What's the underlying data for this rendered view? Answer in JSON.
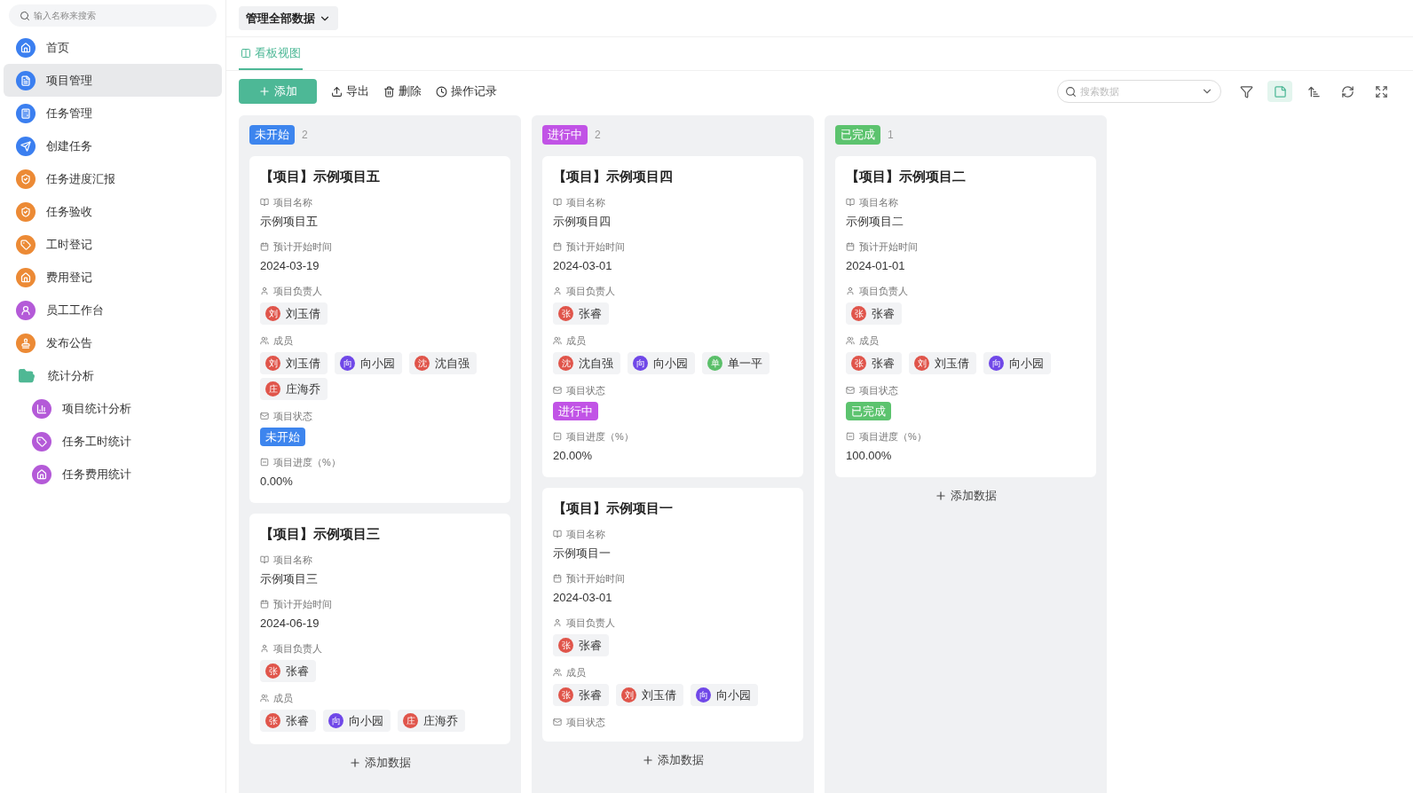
{
  "sidebar": {
    "search": {
      "placeholder": "输入名称来搜索"
    },
    "items": [
      {
        "label": "首页",
        "color": "#3b7ff0",
        "selected": false
      },
      {
        "label": "项目管理",
        "color": "#3b7ff0",
        "selected": true
      },
      {
        "label": "任务管理",
        "color": "#3b7ff0",
        "selected": false
      },
      {
        "label": "创建任务",
        "color": "#3b7ff0",
        "selected": false
      },
      {
        "label": "任务进度汇报",
        "color": "#ec8a35",
        "selected": false
      },
      {
        "label": "任务验收",
        "color": "#ec8a35",
        "selected": false
      },
      {
        "label": "工时登记",
        "color": "#ec8a35",
        "selected": false
      },
      {
        "label": "费用登记",
        "color": "#ec8a35",
        "selected": false
      },
      {
        "label": "员工工作台",
        "color": "#b45ad8",
        "selected": false
      },
      {
        "label": "发布公告",
        "color": "#ec8a35",
        "selected": false
      },
      {
        "label": "统计分析",
        "color": "#4fb894",
        "selected": false,
        "expanded": true,
        "children": [
          {
            "label": "项目统计分析",
            "color": "#b45ad8",
            "selected": false
          },
          {
            "label": "任务工时统计",
            "color": "#b45ad8",
            "selected": false
          },
          {
            "label": "任务费用统计",
            "color": "#b45ad8",
            "selected": false
          }
        ]
      }
    ]
  },
  "scope_dropdown": "管理全部数据",
  "tabs": [
    {
      "label": "看板视图",
      "selected": true
    }
  ],
  "toolbar": {
    "actions": [
      {
        "kind": "add",
        "label": "添加"
      },
      {
        "kind": "export",
        "label": "导出"
      },
      {
        "kind": "delete",
        "label": "删除"
      },
      {
        "kind": "history",
        "label": "操作记录"
      }
    ],
    "search": {
      "placeholder": "搜索数据"
    },
    "tools": [
      {
        "kind": "filter",
        "selected": false
      },
      {
        "kind": "kanban",
        "selected": true
      },
      {
        "kind": "sort",
        "selected": false
      },
      {
        "kind": "refresh",
        "selected": false
      },
      {
        "kind": "fullscreen",
        "selected": false
      }
    ]
  },
  "columns": [
    {
      "status": "未开始",
      "color": "#3d85ee",
      "count": "2",
      "add_label": "添加数据",
      "cards": [
        {
          "title": "【项目】示例项目五",
          "fields": [
            {
              "kind": "name",
              "label": "项目名称",
              "value": "示例项目五"
            },
            {
              "kind": "date",
              "label": "预计开始时间",
              "value": "2024-03-19"
            },
            {
              "kind": "owner",
              "label": "项目负责人",
              "people": [
                {
                  "initial": "刘",
                  "name": "刘玉倩",
                  "color": "#e0554b"
                }
              ]
            },
            {
              "kind": "members",
              "label": "成员",
              "people": [
                {
                  "initial": "刘",
                  "name": "刘玉倩",
                  "color": "#e0554b"
                },
                {
                  "initial": "向",
                  "name": "向小园",
                  "color": "#7048e8"
                },
                {
                  "initial": "沈",
                  "name": "沈自强",
                  "color": "#e0554b"
                },
                {
                  "initial": "庄",
                  "name": "庄海乔",
                  "color": "#e0554b"
                }
              ]
            },
            {
              "kind": "status",
              "label": "项目状态",
              "value": "未开始",
              "color": "#3d85ee"
            },
            {
              "kind": "progress",
              "label": "项目进度（%）",
              "value": "0.00%"
            }
          ]
        },
        {
          "title": "【项目】示例项目三",
          "fields": [
            {
              "kind": "name",
              "label": "项目名称",
              "value": "示例项目三"
            },
            {
              "kind": "date",
              "label": "预计开始时间",
              "value": "2024-06-19"
            },
            {
              "kind": "owner",
              "label": "项目负责人",
              "people": [
                {
                  "initial": "张",
                  "name": "张睿",
                  "color": "#e0554b"
                }
              ]
            },
            {
              "kind": "members",
              "label": "成员",
              "people": [
                {
                  "initial": "张",
                  "name": "张睿",
                  "color": "#e0554b"
                },
                {
                  "initial": "向",
                  "name": "向小园",
                  "color": "#7048e8"
                },
                {
                  "initial": "庄",
                  "name": "庄海乔",
                  "color": "#e0554b"
                }
              ]
            }
          ]
        }
      ]
    },
    {
      "status": "进行中",
      "color": "#c153e6",
      "count": "2",
      "add_label": "添加数据",
      "cards": [
        {
          "title": "【项目】示例项目四",
          "fields": [
            {
              "kind": "name",
              "label": "项目名称",
              "value": "示例项目四"
            },
            {
              "kind": "date",
              "label": "预计开始时间",
              "value": "2024-03-01"
            },
            {
              "kind": "owner",
              "label": "项目负责人",
              "people": [
                {
                  "initial": "张",
                  "name": "张睿",
                  "color": "#e0554b"
                }
              ]
            },
            {
              "kind": "members",
              "label": "成员",
              "people": [
                {
                  "initial": "沈",
                  "name": "沈自强",
                  "color": "#e0554b"
                },
                {
                  "initial": "向",
                  "name": "向小园",
                  "color": "#7048e8"
                },
                {
                  "initial": "单",
                  "name": "单一平",
                  "color": "#5bbf6a"
                }
              ]
            },
            {
              "kind": "status",
              "label": "项目状态",
              "value": "进行中",
              "color": "#c153e6"
            },
            {
              "kind": "progress",
              "label": "项目进度（%）",
              "value": "20.00%"
            }
          ]
        },
        {
          "title": "【项目】示例项目一",
          "fields": [
            {
              "kind": "name",
              "label": "项目名称",
              "value": "示例项目一"
            },
            {
              "kind": "date",
              "label": "预计开始时间",
              "value": "2024-03-01"
            },
            {
              "kind": "owner",
              "label": "项目负责人",
              "people": [
                {
                  "initial": "张",
                  "name": "张睿",
                  "color": "#e0554b"
                }
              ]
            },
            {
              "kind": "members",
              "label": "成员",
              "people": [
                {
                  "initial": "张",
                  "name": "张睿",
                  "color": "#e0554b"
                },
                {
                  "initial": "刘",
                  "name": "刘玉倩",
                  "color": "#e0554b"
                },
                {
                  "initial": "向",
                  "name": "向小园",
                  "color": "#7048e8"
                }
              ]
            },
            {
              "kind": "status_label",
              "label": "项目状态"
            }
          ]
        }
      ]
    },
    {
      "status": "已完成",
      "color": "#5cc36e",
      "count": "1",
      "add_label": "添加数据",
      "cards": [
        {
          "title": "【项目】示例项目二",
          "fields": [
            {
              "kind": "name",
              "label": "项目名称",
              "value": "示例项目二"
            },
            {
              "kind": "date",
              "label": "预计开始时间",
              "value": "2024-01-01"
            },
            {
              "kind": "owner",
              "label": "项目负责人",
              "people": [
                {
                  "initial": "张",
                  "name": "张睿",
                  "color": "#e0554b"
                }
              ]
            },
            {
              "kind": "members",
              "label": "成员",
              "people": [
                {
                  "initial": "张",
                  "name": "张睿",
                  "color": "#e0554b"
                },
                {
                  "initial": "刘",
                  "name": "刘玉倩",
                  "color": "#e0554b"
                },
                {
                  "initial": "向",
                  "name": "向小园",
                  "color": "#7048e8"
                }
              ]
            },
            {
              "kind": "status",
              "label": "项目状态",
              "value": "已完成",
              "color": "#5cc36e"
            },
            {
              "kind": "progress",
              "label": "项目进度（%）",
              "value": "100.00%"
            }
          ]
        }
      ]
    }
  ]
}
